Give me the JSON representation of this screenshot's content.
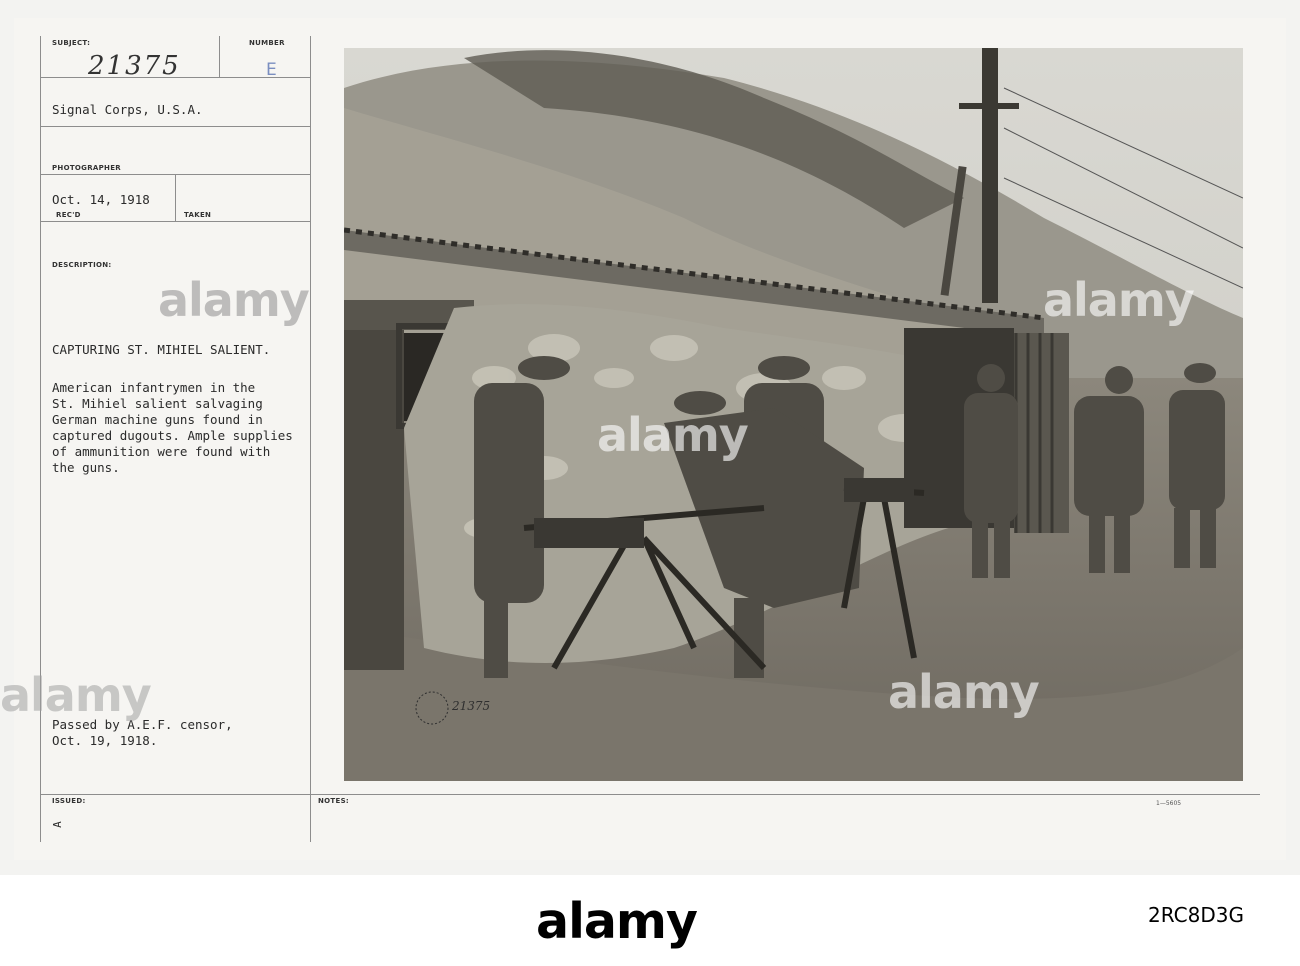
{
  "record": {
    "subject_label": "SUBJECT:",
    "number_label": "NUMBER",
    "subject_number": "21375",
    "number_stamp": "E",
    "agency": "Signal Corps, U.S.A.",
    "photographer_label": "PHOTOGRAPHER",
    "date_received": "Oct. 14, 1918",
    "recd_label": "REC'D",
    "taken_label": "TAKEN",
    "description_label": "DESCRIPTION:",
    "title": "CAPTURING ST. MIHIEL SALIENT.",
    "description_lines": [
      "American infantrymen in the",
      "St. Mihiel salient salvaging",
      "German machine guns found in",
      "captured dugouts. Ample supplies",
      "of ammunition were found with",
      "the guns."
    ],
    "censor_lines": [
      "Passed by A.E.F. censor,",
      "Oct. 19, 1918."
    ],
    "issued_label": "ISSUED:",
    "issued_mark": "A",
    "notes_label": "NOTES:",
    "form_code": "1—5605"
  },
  "photo": {
    "negative_number": "21375",
    "watermark": "alamy"
  },
  "footer": {
    "logo": "alamy",
    "image_id": "2RC8D3G"
  }
}
